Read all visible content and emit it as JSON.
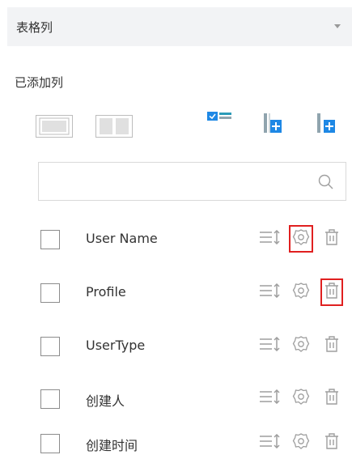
{
  "header": {
    "title": "表格列"
  },
  "section": {
    "title": "已添加列"
  },
  "toolbar": {
    "icons": [
      "full-width-layout-icon",
      "split-layout-icon",
      "check-column-icon",
      "add-column-icon",
      "add-column-right-icon"
    ]
  },
  "search": {
    "value": "",
    "placeholder": ""
  },
  "columns": [
    {
      "label": "User Name"
    },
    {
      "label": "Profile"
    },
    {
      "label": "UserType"
    },
    {
      "label": "创建人"
    },
    {
      "label": "创建时间"
    }
  ],
  "colors": {
    "header_bg": "#f2f3f5",
    "accent_blue": "#1e88e5",
    "teal": "#2b9bb8",
    "highlight": "#e02020",
    "icon_gray": "#9e9e9e"
  }
}
